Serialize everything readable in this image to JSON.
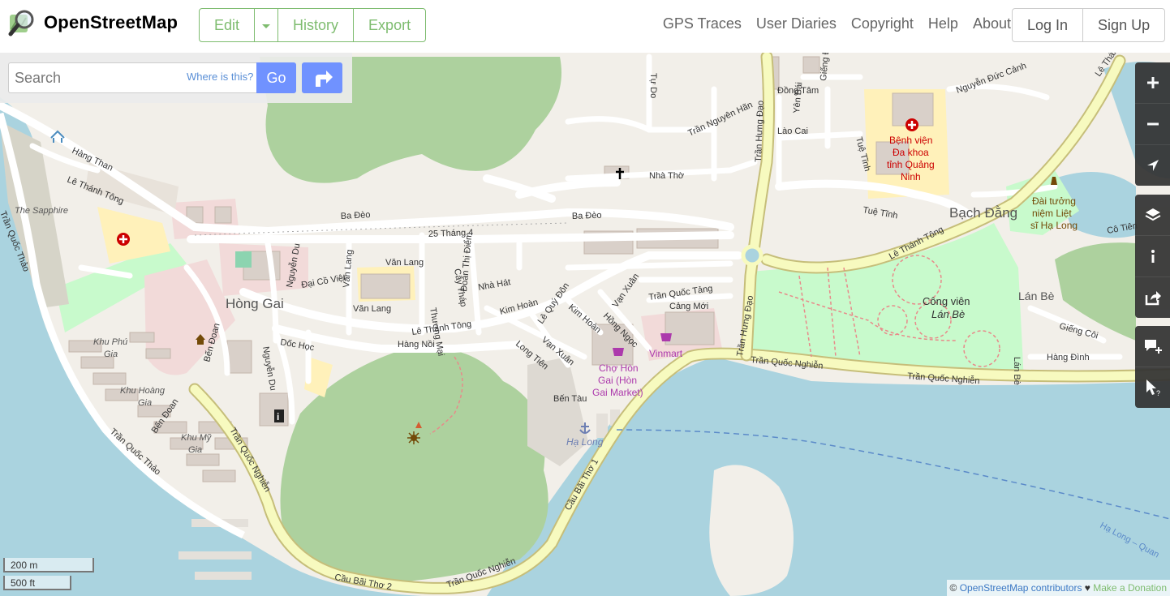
{
  "header": {
    "brand": "OpenStreetMap",
    "edit_label": "Edit",
    "history_label": "History",
    "export_label": "Export",
    "nav": [
      "GPS Traces",
      "User Diaries",
      "Copyright",
      "Help",
      "About"
    ],
    "login_label": "Log In",
    "signup_label": "Sign Up"
  },
  "search": {
    "placeholder": "Search",
    "where_is_this": "Where is this?",
    "go_label": "Go"
  },
  "controls": [
    "zoom-in-icon",
    "zoom-out-icon",
    "locate-icon",
    "layers-icon",
    "info-icon",
    "share-icon",
    "add-note-icon",
    "query-features-icon"
  ],
  "scale": {
    "metric": "200 m",
    "imperial": "500 ft"
  },
  "attribution": {
    "copy": "© ",
    "osm": "OpenStreetMap contributors",
    "heart": " ♥ ",
    "donate": "Make a Donation"
  },
  "colors": {
    "brand_green": "#7ebc6f",
    "button_blue": "#7092ff",
    "water": "#aad3df",
    "park": "#c8facc",
    "wood": "#add19e",
    "primary_road": "#f7fabf"
  },
  "map": {
    "streets": {
      "le_thanh_tong_w": "Lê Thánh Tông",
      "hang_than": "Hàng Than",
      "ba_deo_1": "Ba Đèo",
      "ba_deo_2": "Ba Đèo",
      "thang_25_4": "25 Tháng 4",
      "nha_tho": "Nhà Thờ",
      "tran_nguyen_han": "Trần Nguyên Hãn",
      "tu_do": "Tự Do",
      "tran_hung_dao_n": "Trần Hưng Đạo",
      "dong_tam": "Đồng Tâm",
      "lao_cai": "Lào Cai",
      "yen_bai": "Yên Bái",
      "gieng_d": "Giếng Đ",
      "nguyen_duc_canh": "Nguyễn Đức Cảnh",
      "tue_tinh_1": "Tuệ Tĩnh",
      "tue_tinh_2": "Tuệ Tĩnh",
      "le_thanh_tong_e": "Lê Thánh Tông",
      "co_tien": "Cô Tiên",
      "le_thanh_tong_nw": "Lê Thánh Tông",
      "nguyen_du_1": "Nguyễn Du",
      "dai_co_viet": "Đại Cồ Việt",
      "van_lang_1": "Văn Lang",
      "van_lang_2": "Văn Lang",
      "van_lang_3": "Văn Lang",
      "thuong_mai": "Thương Mại",
      "cay_thap": "Cây Tháp",
      "doan_thi_diem": "Đoàn Thị Điểm",
      "nha_hat": "Nhà Hát",
      "le_thanh_tong_c": "Lê Thánh Tông",
      "hang_noi": "Hàng Nồi",
      "kim_hoan_1": "Kim Hoàn",
      "kim_hoan_2": "Kim Hoàn",
      "le_quy_don": "Lê Quý Đôn",
      "van_xuan_1": "Vạn Xuân",
      "van_xuan_2": "Vạn Xuân",
      "hong_ngoc": "Hồng Ngọc",
      "long_tien": "Long Tiên",
      "tran_quoc_tang": "Trần Quốc Tảng",
      "cang_moi": "Cảng Mới",
      "tran_hung_dao_s": "Trần Hưng Đạo",
      "tran_quoc_nghien_1": "Trần Quốc Nghiễn",
      "tran_quoc_nghien_2": "Trần Quốc Nghiễn",
      "tran_quoc_nghien_3": "Trần Quốc Nghiễn",
      "tran_quoc_nghien_4": "Trần Quốc Nghiễn",
      "tran_quoc_nghien_5": "Trần Quốc Nghiễn",
      "le_be": "Lán Bè",
      "gieng_coi": "Giếng Côi",
      "hang_dinh": "Hàng Đình",
      "tran_quoc_thao_1": "Trần Quốc Thảo",
      "tran_quoc_thao_2": "Trần Quốc Thảo",
      "ben_doan_1": "Bến Đoan",
      "ben_doan_2": "Bến Đoan",
      "doc_hoc": "Dốc Học",
      "nguyen_du_2": "Nguyễn Du",
      "cau_bai_tho_1": "Cầu Bãi Thơ 1",
      "cau_bai_tho_2": "Cầu Bãi Thơ 2",
      "ben_tau": "Bến Tàu",
      "ha_long_ferry": "Hạ Long – Quan"
    },
    "places": {
      "hong_gai": "Hòng Gai",
      "bach_dang": "Bạch Đằng",
      "lan_be": "Lán Bè",
      "the_sapphire": "The Sapphire",
      "khu_phu_gia_1": "Khu Phú",
      "khu_phu_gia_2": "Gia",
      "khu_hoang_gia_1": "Khu Hoàng",
      "khu_hoang_gia_2": "Gia",
      "khu_my_gia_1": "Khu Mỹ",
      "khu_my_gia_2": "Gia",
      "benh_vien_1": "Bệnh viện",
      "benh_vien_2": "Đa khoa",
      "benh_vien_3": "tỉnh Quảng",
      "benh_vien_4": "Ninh",
      "dai_tuong_niem_1": "Đài tưởng",
      "dai_tuong_niem_2": "niệm Liệt",
      "dai_tuong_niem_3": "sĩ Hạ Long",
      "cong_vien_1": "Công viên",
      "cong_vien_2": "Lán Bè",
      "vinmart": "Vinmart",
      "cho_hon_gai_1": "Chợ Hòn",
      "cho_hon_gai_2": "Gai (Hòn",
      "cho_hon_gai_3": "Gai Market)",
      "ha_long": "Hạ Long"
    }
  }
}
